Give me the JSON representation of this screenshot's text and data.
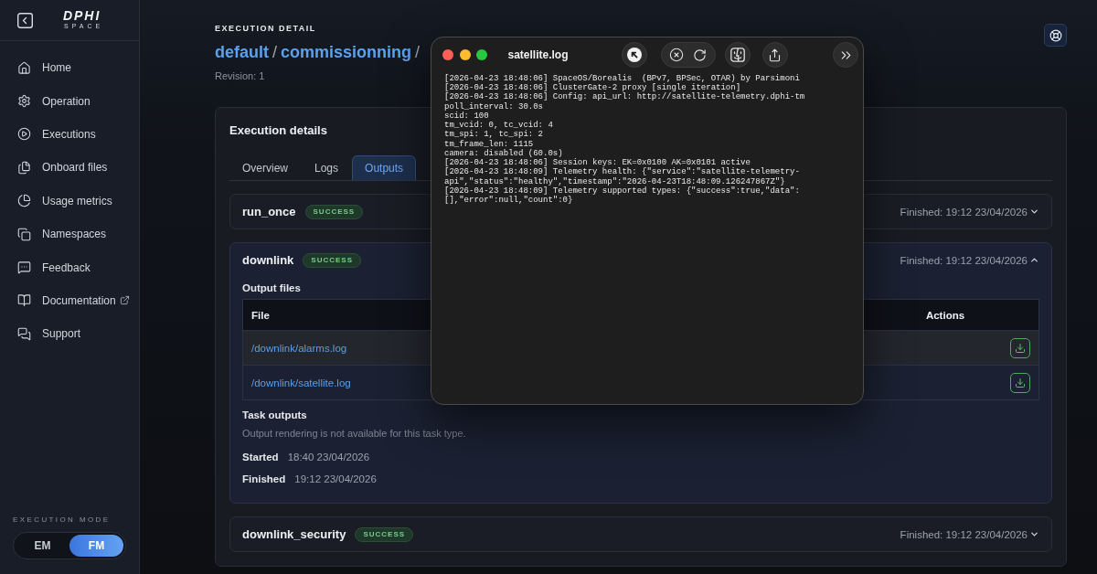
{
  "sidebar": {
    "logo": {
      "wordmark": "DPHI",
      "tagline": "SPACE"
    },
    "items": [
      {
        "label": "Home",
        "selected": false,
        "external": false
      },
      {
        "label": "Operation",
        "selected": false,
        "external": false
      },
      {
        "label": "Executions",
        "selected": false,
        "external": false
      },
      {
        "label": "Onboard files",
        "selected": false,
        "external": false
      },
      {
        "label": "Usage metrics",
        "selected": false,
        "external": false
      },
      {
        "label": "Namespaces",
        "selected": false,
        "external": false
      },
      {
        "label": "Feedback",
        "selected": false,
        "external": false
      },
      {
        "label": "Documentation",
        "selected": false,
        "external": true
      },
      {
        "label": "Support",
        "selected": false,
        "external": false
      }
    ],
    "execution_mode": {
      "label": "EXECUTION MODE",
      "options": [
        {
          "label": "EM",
          "selected": false
        },
        {
          "label": "FM",
          "selected": true
        }
      ]
    }
  },
  "header": {
    "eyebrow": "EXECUTION DETAIL",
    "breadcrumb": [
      {
        "kind": "link",
        "text": "default"
      },
      {
        "kind": "separator",
        "text": "/"
      },
      {
        "kind": "link",
        "text": "commissionning"
      },
      {
        "kind": "separator",
        "text": "/"
      }
    ],
    "revision": "Revision: 1"
  },
  "card": {
    "title": "Execution details",
    "tabs": [
      {
        "label": "Overview",
        "selected": false
      },
      {
        "label": "Logs",
        "selected": false
      },
      {
        "label": "Outputs",
        "selected": true
      }
    ],
    "tasks": [
      {
        "name": "run_once",
        "status": "SUCCESS",
        "finished": "Finished: 19:12 23/04/2026",
        "expanded": false
      },
      {
        "name": "downlink",
        "status": "SUCCESS",
        "finished": "Finished: 19:12 23/04/2026",
        "expanded": true,
        "details": {
          "output_files": {
            "title": "Output files",
            "columns": [
              "File",
              "Actions"
            ],
            "rows": [
              {
                "file": "/downlink/alarms.log",
                "highlighted": true
              },
              {
                "file": "/downlink/satellite.log",
                "highlighted": false
              }
            ]
          },
          "task_outputs": {
            "title": "Task outputs",
            "note": "Output rendering is not available for this task type."
          },
          "times": [
            {
              "label": "Started",
              "value": "18:40 23/04/2026"
            },
            {
              "label": "Finished",
              "value": "19:12 23/04/2026"
            }
          ]
        }
      },
      {
        "name": "downlink_security",
        "status": "SUCCESS",
        "finished": "Finished: 19:12 23/04/2026",
        "expanded": false
      }
    ]
  },
  "log_window": {
    "title": "satellite.log",
    "lines": [
      "[2026-04-23 18:48:06] SpaceOS/Borealis  (BPv7, BPSec, OTAR) by Parsimoni",
      "[2026-04-23 18:48:06] ClusterGate-2 proxy [single iteration]",
      "[2026-04-23 18:48:06] Config: api_url: http://satellite-telemetry.dphi-tm",
      "poll_interval: 30.0s",
      "scid: 100",
      "tm_vcid: 0, tc_vcid: 4",
      "tm_spi: 1, tc_spi: 2",
      "tm_frame_len: 1115",
      "camera: disabled (60.0s)",
      "[2026-04-23 18:48:06] Session keys: EK=0x0100 AK=0x0101 active",
      "[2026-04-23 18:48:09] Telemetry health: {\"service\":\"satellite-telemetry-",
      "api\",\"status\":\"healthy\",\"timestamp\":\"2026-04-23T18:48:09.126247867Z\"}",
      "[2026-04-23 18:48:09] Telemetry supported types: {\"success\":true,\"data\":",
      "[],\"error\":null,\"count\":0}"
    ]
  }
}
